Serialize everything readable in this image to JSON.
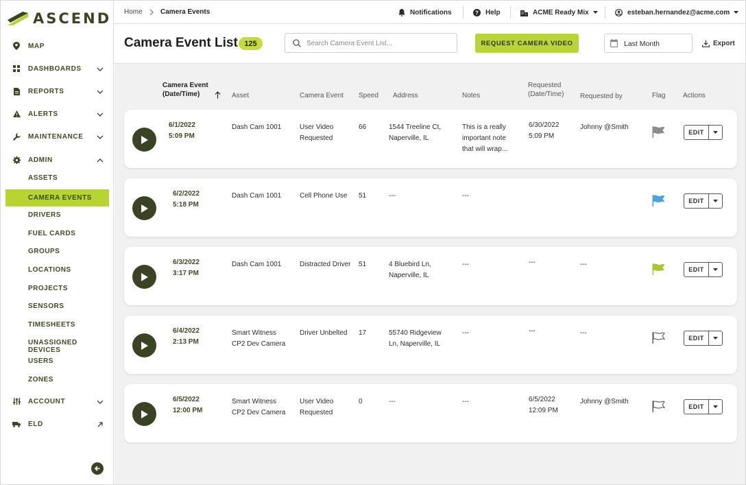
{
  "app": {
    "logo_text": "ASCEND"
  },
  "sidebar": {
    "items": [
      {
        "label": "MAP",
        "icon": "map-pin-icon"
      },
      {
        "label": "DASHBOARDS",
        "icon": "dashboard-grid-icon"
      },
      {
        "label": "REPORTS",
        "icon": "report-icon"
      },
      {
        "label": "ALERTS",
        "icon": "alert-triangle-icon"
      },
      {
        "label": "MAINTENANCE",
        "icon": "wrench-icon"
      },
      {
        "label": "ADMIN",
        "icon": "gear-icon"
      }
    ],
    "admin_sub": [
      {
        "label": "ASSETS"
      },
      {
        "label": "CAMERA EVENTS",
        "active": true
      },
      {
        "label": "DRIVERS"
      },
      {
        "label": "FUEL CARDS"
      },
      {
        "label": "GROUPS"
      },
      {
        "label": "LOCATIONS"
      },
      {
        "label": "PROJECTS"
      },
      {
        "label": "SENSORS"
      },
      {
        "label": "TIMESHEETS"
      },
      {
        "label": "UNASSIGNED DEVICES"
      },
      {
        "label": "USERS"
      },
      {
        "label": "ZONES"
      }
    ],
    "bottom_items": [
      {
        "label": "ACCOUNT",
        "icon": "sliders-icon"
      },
      {
        "label": "ELD",
        "icon": "truck-icon"
      }
    ]
  },
  "topbar": {
    "breadcrumb": [
      "Home",
      "Camera Events"
    ],
    "notifications": "Notifications",
    "help": "Help",
    "company": "ACME Ready Mix",
    "user": "esteban.hernandez@acme.com"
  },
  "header": {
    "title": "Camera Event List",
    "count": "125",
    "search_placeholder": "Search Camera Event List...",
    "request_button": "REQUEST CAMERA VIDEO",
    "date_range": "Last Month",
    "export": "Export"
  },
  "table": {
    "columns": {
      "camera_event_date": [
        "Camera Event",
        "(Date/Time)"
      ],
      "asset": "Asset",
      "camera_event": "Camera Event",
      "speed": "Speed",
      "address": "Address",
      "notes": "Notes",
      "requested": [
        "Requested",
        "(Date/Time)"
      ],
      "requested_by": "Requested by",
      "flag": "Flag",
      "actions": "Actions"
    },
    "edit_label": "EDIT",
    "rows": [
      {
        "date": "6/1/2022",
        "time": "5:09 PM",
        "asset": [
          "Dash Cam 1001",
          ""
        ],
        "event": [
          "User Video",
          "Requested"
        ],
        "speed": "66",
        "address": [
          "1544 Treeline Ct,",
          "Naperville, IL"
        ],
        "notes": [
          "This is a really",
          "important note",
          "that will wrap..."
        ],
        "requested": [
          "6/30/2022",
          "5:09 PM"
        ],
        "requested_by": "Johnny @Smith",
        "flag_color": "#8c8c8c",
        "flag_style": "filled"
      },
      {
        "date": "6/2/2022",
        "time": "5:18 PM",
        "asset": [
          "Dash Cam 1001",
          ""
        ],
        "event": [
          "Cell Phone Use",
          ""
        ],
        "speed": "51",
        "address": [
          "---",
          ""
        ],
        "notes": [
          "---",
          "",
          ""
        ],
        "requested": [
          "",
          ""
        ],
        "requested_by": "",
        "flag_color": "#4aa3dc",
        "flag_style": "filled"
      },
      {
        "date": "6/3/2022",
        "time": "3:17 PM",
        "asset": [
          "Dash Cam 1001",
          ""
        ],
        "event": [
          "Distracted Driver",
          ""
        ],
        "speed": "51",
        "address": [
          "4 Bluebird Ln,",
          "Naperville, IL"
        ],
        "notes": [
          "---",
          "",
          ""
        ],
        "requested": [
          "---",
          ""
        ],
        "requested_by": "---",
        "flag_color": "#a8c832",
        "flag_style": "filled"
      },
      {
        "date": "6/4/2022",
        "time": "2:13 PM",
        "asset": [
          "Smart Witness",
          "CP2 Dev Camera"
        ],
        "event": [
          "Driver Unbelted",
          ""
        ],
        "speed": "17",
        "address": [
          "55740 Ridgeview",
          "Ln, Naperville, IL"
        ],
        "notes": [
          "---",
          "",
          ""
        ],
        "requested": [
          "---",
          ""
        ],
        "requested_by": "---",
        "flag_color": "#555555",
        "flag_style": "outline"
      },
      {
        "date": "6/5/2022",
        "time": "12:00 PM",
        "asset": [
          "Smart Witness",
          "CP2 Dev Camera"
        ],
        "event": [
          "User Video",
          "Requested"
        ],
        "speed": "0",
        "address": [
          "---",
          ""
        ],
        "notes": [
          "---",
          "",
          ""
        ],
        "requested": [
          "6/5/2022",
          "12:09 PM"
        ],
        "requested_by": "Johnny @Smith",
        "flag_color": "#555555",
        "flag_style": "outline"
      }
    ]
  }
}
